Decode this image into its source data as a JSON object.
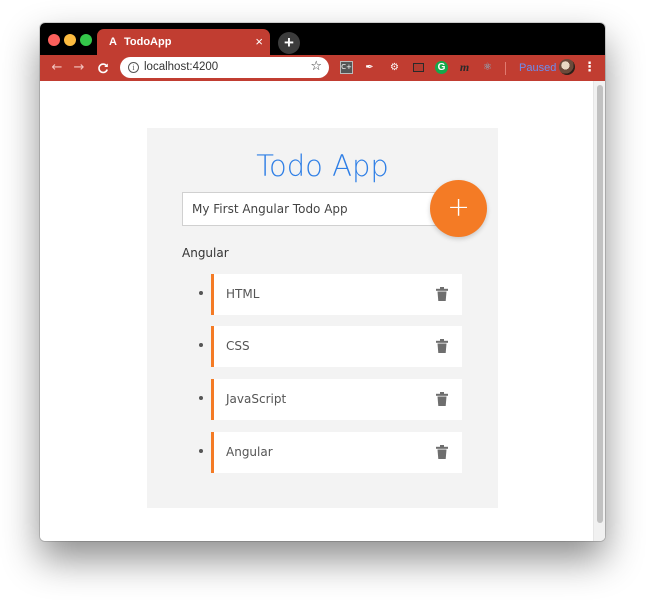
{
  "browser": {
    "tab_title": "TodoApp",
    "tab_favicon": "A",
    "tab_close": "×",
    "new_tab": "+",
    "url": "localhost:4200",
    "profile_status": "Paused",
    "nav": {
      "back": "←",
      "forward": "→",
      "reload": "C"
    },
    "extensions": [
      "chrome-extension-icon",
      "pen-icon",
      "settings-extension-icon",
      "screenshot-icon",
      "grammarly-icon",
      "m-icon",
      "react-devtools-icon"
    ],
    "extension_glyphs": {
      "box": "C+",
      "pen": "✒",
      "gear": "⚙",
      "g": "G",
      "m": "m",
      "atom": "⚛"
    }
  },
  "app": {
    "title": "Todo App",
    "input_value": "My First Angular Todo App",
    "add_button": "+",
    "list_title": "Angular",
    "todos": [
      {
        "label": "HTML"
      },
      {
        "label": "CSS"
      },
      {
        "label": "JavaScript"
      },
      {
        "label": "Angular"
      }
    ]
  },
  "colors": {
    "browser_theme": "#c13d31",
    "accent": "#f47b25",
    "title_blue": "#2f7fe6",
    "card_bg": "#f3f3f3"
  }
}
